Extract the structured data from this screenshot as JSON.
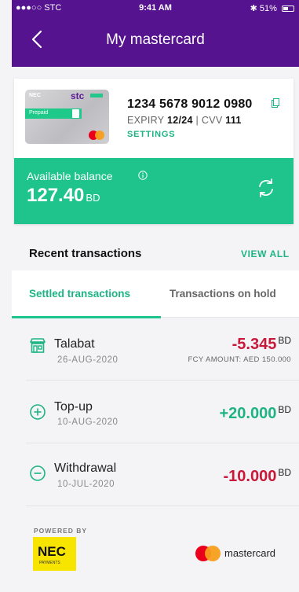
{
  "status_bar": {
    "carrier": "●●●○○ STC",
    "time": "9:41 AM",
    "battery": "51%"
  },
  "header": {
    "title": "My mastercard"
  },
  "card": {
    "brand": "stc",
    "issuer": "NEC",
    "label": "Prepaid",
    "number": "1234 5678 9012 0980",
    "expiry_label": "EXPIRY",
    "expiry_value": "12/24",
    "cvv_label": "CVV",
    "cvv_value": "111",
    "separator": "|",
    "settings_label": "SETTINGS"
  },
  "balance": {
    "label": "Available balance",
    "amount": "127.40",
    "currency": "BD"
  },
  "recent": {
    "title": "Recent transactions",
    "view_all_label": "VIEW ALL",
    "tabs": [
      {
        "label": "Settled transactions",
        "active": true
      },
      {
        "label": "Transactions on hold",
        "active": false
      }
    ],
    "transactions": [
      {
        "name": "Talabat",
        "date": "26-AUG-2020",
        "amount": "-5.345",
        "currency": "BD",
        "fcy": "FCY AMOUNT: AED 150.000",
        "icon": "store-icon"
      },
      {
        "name": "Top-up",
        "date": "10-AUG-2020",
        "amount": "+20.000",
        "currency": "BD",
        "icon": "plus-circle-icon"
      },
      {
        "name": "Withdrawal",
        "date": "10-JUL-2020",
        "amount": "-10.000",
        "currency": "BD",
        "icon": "minus-circle-icon"
      }
    ]
  },
  "footer": {
    "powered_by": "POWERED BY",
    "nec_logo": "NEC",
    "nec_subtitle": "PAYMENTS",
    "mastercard_label": "mastercard"
  },
  "colors": {
    "header": "#56138f",
    "accent": "#1fc48c",
    "negative": "#c8193a",
    "positive": "#1fb383"
  }
}
